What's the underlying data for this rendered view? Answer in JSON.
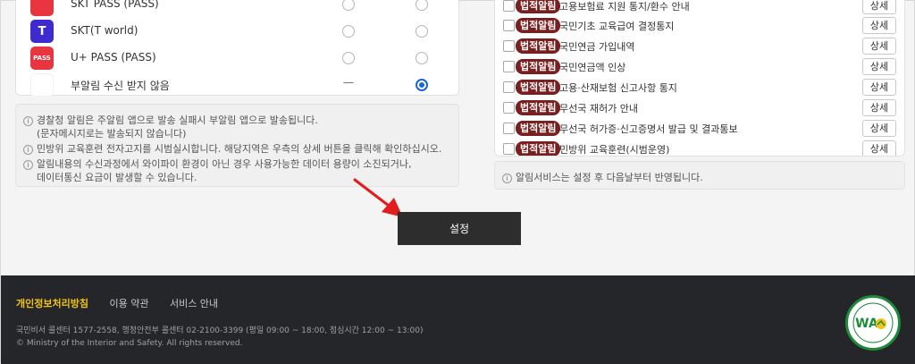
{
  "apps": [
    {
      "label": "SKT PASS (PASS)",
      "icon": "skt-pass-icon",
      "icon_text": "",
      "color": "#e8353f"
    },
    {
      "label": "SKT(T world)",
      "icon": "t-world-icon",
      "icon_text": "T",
      "color": "#3d2bd0"
    },
    {
      "label": "U+ PASS (PASS)",
      "icon": "uplus-pass-icon",
      "icon_text": "PASS",
      "color": "#e8353f"
    },
    {
      "label": "부알림 수신 받지 않음",
      "icon": "none-icon",
      "icon_text": "",
      "color": "#ffffff"
    }
  ],
  "left_notices": [
    "경찰청 알림은 주알림 앱으로 발송 실패시 부알림 앱으로 발송됩니다.",
    "(문자메시지로는 발송되지 않습니다)",
    "민방위 교육훈련 전자고지를 시범실시합니다. 해당지역은 우측의 상세 버튼을 클릭해 확인하십시오.",
    "알림내용의 수신과정에서 와이파이 환경이 아닌 경우 사용가능한 데이터 용량이 소진되거나,",
    "데이터통신 요금이 발생할 수 있습니다."
  ],
  "dash_symbol": "—",
  "law_items": [
    {
      "badge": "법적알림",
      "title": "고용보험료 지원 통지/환수 안내",
      "button": "상세"
    },
    {
      "badge": "법적알림",
      "title": "국민기초 교육급여 결정통지",
      "button": "상세"
    },
    {
      "badge": "법적알림",
      "title": "국민연금 가입내역",
      "button": "상세"
    },
    {
      "badge": "법적알림",
      "title": "국민연금액 인상",
      "button": "상세"
    },
    {
      "badge": "법적알림",
      "title": "고용·산재보험 신고사항 통지",
      "button": "상세"
    },
    {
      "badge": "법적알림",
      "title": "무선국 재허가 안내",
      "button": "상세"
    },
    {
      "badge": "법적알림",
      "title": "무선국 허가증·신고증명서 발급 및 결과통보",
      "button": "상세"
    },
    {
      "badge": "법적알림",
      "title": "민방위 교육훈련(시범운영)",
      "button": "상세"
    }
  ],
  "right_notice": "알림서비스는 설정 후 다음날부터 반영됩니다.",
  "submit_label": "설정",
  "footer": {
    "links": [
      "개인정보처리방침",
      "이용 약관",
      "서비스 안내"
    ],
    "info": "국민비서 콜센터 1577-2558, 행정안전부 콜센터 02-2100-3399 (평일 09:00 ~ 18:00, 점심시간 12:00 ~ 13:00)",
    "copyright": "© Ministry of the Interior and Safety. All rights reserved.",
    "wa_label": "WA"
  },
  "colors": {
    "accent": "#1967d2",
    "badge": "#7a1f1f",
    "footer_bg": "#252629",
    "privacy_link": "#f0c419",
    "arrow": "#e21d1d"
  }
}
